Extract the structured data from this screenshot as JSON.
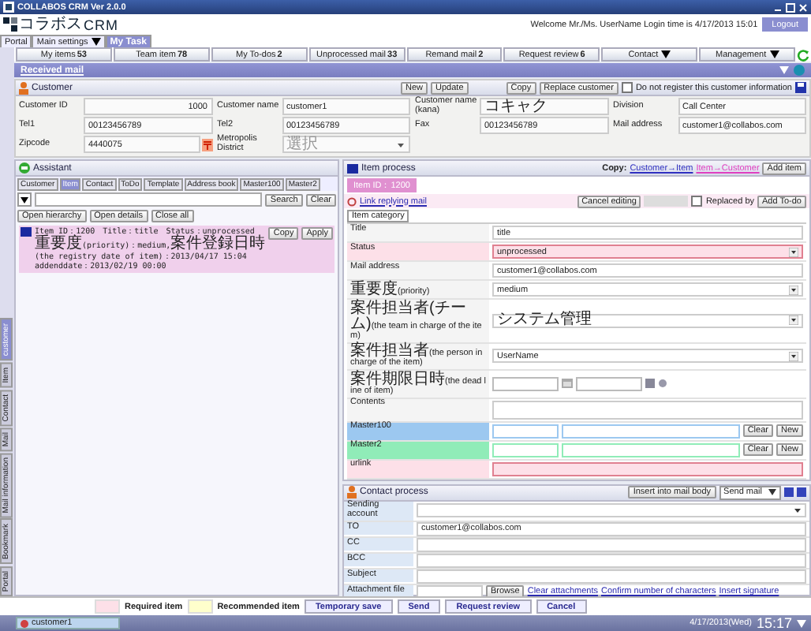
{
  "window": {
    "title": "COLLABOS CRM Ver 2.0.0"
  },
  "logo": {
    "ja": "コラボス",
    "en": "CRM"
  },
  "header": {
    "welcome": "Welcome Mr./Ms. UserName Login time is 4/17/2013 15:01",
    "logout": "Logout"
  },
  "tabs": [
    {
      "label": "Portal",
      "selected": false,
      "menu": false
    },
    {
      "label": "Main settings",
      "selected": false,
      "menu": true
    },
    {
      "label": "My Task",
      "selected": true,
      "menu": false
    }
  ],
  "side_tabs": [
    {
      "label": "customer",
      "selected": true
    },
    {
      "label": "Item",
      "selected": false
    },
    {
      "label": "Contact",
      "selected": false
    },
    {
      "label": "Mail",
      "selected": false
    },
    {
      "label": "Mail information",
      "selected": false
    },
    {
      "label": "Bookmark",
      "selected": false
    },
    {
      "label": "Portal",
      "selected": false
    }
  ],
  "nav": [
    {
      "label": "My items",
      "count": "53",
      "menu": false
    },
    {
      "label": "Team item",
      "count": "78",
      "menu": false
    },
    {
      "label": "My To-dos",
      "count": "2",
      "menu": false
    },
    {
      "label": "Unprocessed mail",
      "count": "33",
      "menu": false
    },
    {
      "label": "Remand mail",
      "count": "2",
      "menu": false
    },
    {
      "label": "Request review",
      "count": "6",
      "menu": false
    },
    {
      "label": "Contact",
      "menu": true
    },
    {
      "label": "Management",
      "menu": true
    }
  ],
  "received_mail": "Received mail",
  "customer": {
    "title": "Customer",
    "buttons": [
      "New",
      "Update"
    ],
    "buttons2": [
      "Copy",
      "Replace customer"
    ],
    "do_not_register": {
      "label": "Do not register this customer information",
      "checked": false
    },
    "fields": [
      {
        "label": "Customer ID",
        "value": "1000",
        "kind": "numeric"
      },
      {
        "label": "Customer name",
        "value": "customer1"
      },
      {
        "label": "Customer name (kana)",
        "value_ja": "コキャク"
      },
      {
        "label": "Division",
        "value": "Call Center"
      },
      {
        "label": "Tel1",
        "value": "00123456789"
      },
      {
        "label": "Tel2",
        "value": "00123456789"
      },
      {
        "label": "Fax",
        "value": "00123456789"
      },
      {
        "label": "Mail address",
        "value": "customer1@collabos.com"
      },
      {
        "label": "Zipcode",
        "value": "4440075",
        "kind": "zip"
      },
      {
        "label": "Metropolis District",
        "placeholder_ja": "選択",
        "kind": "select"
      }
    ]
  },
  "assistant": {
    "title": "Assistant",
    "tabs": [
      {
        "label": "Customer",
        "selected": false
      },
      {
        "label": "Item",
        "selected": true
      },
      {
        "label": "Contact",
        "selected": false
      },
      {
        "label": "ToDo",
        "selected": false
      },
      {
        "label": "Template",
        "selected": false
      },
      {
        "label": "Address book",
        "selected": false
      },
      {
        "label": "Master100",
        "selected": false
      },
      {
        "label": "Master2",
        "selected": false
      }
    ],
    "search": "Search",
    "clear": "Clear",
    "buttons": [
      "Open hierarchy",
      "Open details",
      "Close all"
    ],
    "entry": {
      "line1": "Item ID：1200　Title：title　Status：unprocessed",
      "parts": [
        {
          "ja": "重要度",
          "en": "(priority)：medium,"
        },
        {
          "ja": "案件登録日時",
          "en": "(the registry date of item)：2013/04/17 15:04　addenddate：2013/02/19 00:00"
        }
      ],
      "buttons": [
        "Copy",
        "Apply"
      ]
    }
  },
  "item": {
    "title": "Item process",
    "copy_label": "Copy:",
    "links": [
      {
        "label": "Customer→Item",
        "color": "#3030c0"
      },
      {
        "label": "Item→Customer",
        "color": "#e040c0"
      }
    ],
    "add": "Add item",
    "item_id": "Item ID：1200",
    "reply_link": "Link replying mail",
    "cancel": "Cancel editing",
    "replaced": {
      "label": "Replaced by",
      "checked": false
    },
    "add_todo": "Add To-do",
    "tab": "Item category",
    "rows": [
      {
        "kind": "input",
        "label": "Title",
        "value": "title"
      },
      {
        "kind": "select",
        "label": "Status",
        "value": "unprocessed",
        "required": true
      },
      {
        "kind": "input",
        "label": "Mail address",
        "value": "customer1@collabos.com"
      },
      {
        "kind": "select",
        "label_ja": "重要度",
        "label": "(priority)",
        "value": "medium"
      },
      {
        "kind": "select",
        "label_ja": "案件担当者(チーム)",
        "label": "(the team in charge of the item)",
        "value_ja": "システム管理"
      },
      {
        "kind": "select",
        "label_ja": "案件担当者",
        "label": "(the person in charge of the item)",
        "value": "UserName"
      },
      {
        "kind": "date",
        "label_ja": "案件期限日時",
        "label": "(the dead line of item)"
      },
      {
        "kind": "textarea",
        "label": "Contents"
      },
      {
        "kind": "master",
        "label": "Master100",
        "color": "#9cc8f0",
        "clear": "Clear",
        "new": "New"
      },
      {
        "kind": "master",
        "label": "Master2",
        "color": "#90ecb8",
        "clear": "Clear",
        "new": "New"
      },
      {
        "kind": "input",
        "label": "urlink",
        "required": true
      }
    ]
  },
  "contact": {
    "title": "Contact process",
    "insert": "Insert into mail body",
    "mode": "Send mail",
    "rows": [
      {
        "kind": "select",
        "label": "Sending account"
      },
      {
        "kind": "input",
        "label": "TO",
        "value": "customer1@collabos.com"
      },
      {
        "kind": "input",
        "label": "CC"
      },
      {
        "kind": "input",
        "label": "BCC"
      },
      {
        "kind": "input",
        "label": "Subject"
      },
      {
        "kind": "file",
        "label": "Attachment file",
        "browse": "Browse"
      }
    ],
    "links": [
      "Clear attachments",
      "Confirm number of characters",
      "Insert signature"
    ]
  },
  "legend": [
    {
      "label": "Required item",
      "color": "#fde0e8"
    },
    {
      "label": "Recommended item",
      "color": "#ffffcc"
    }
  ],
  "actions": [
    "Temporary save",
    "Send",
    "Request review",
    "Cancel"
  ],
  "taskbar": {
    "item": "customer1",
    "date": "4/17/2013(Wed)",
    "time": "15:17"
  }
}
